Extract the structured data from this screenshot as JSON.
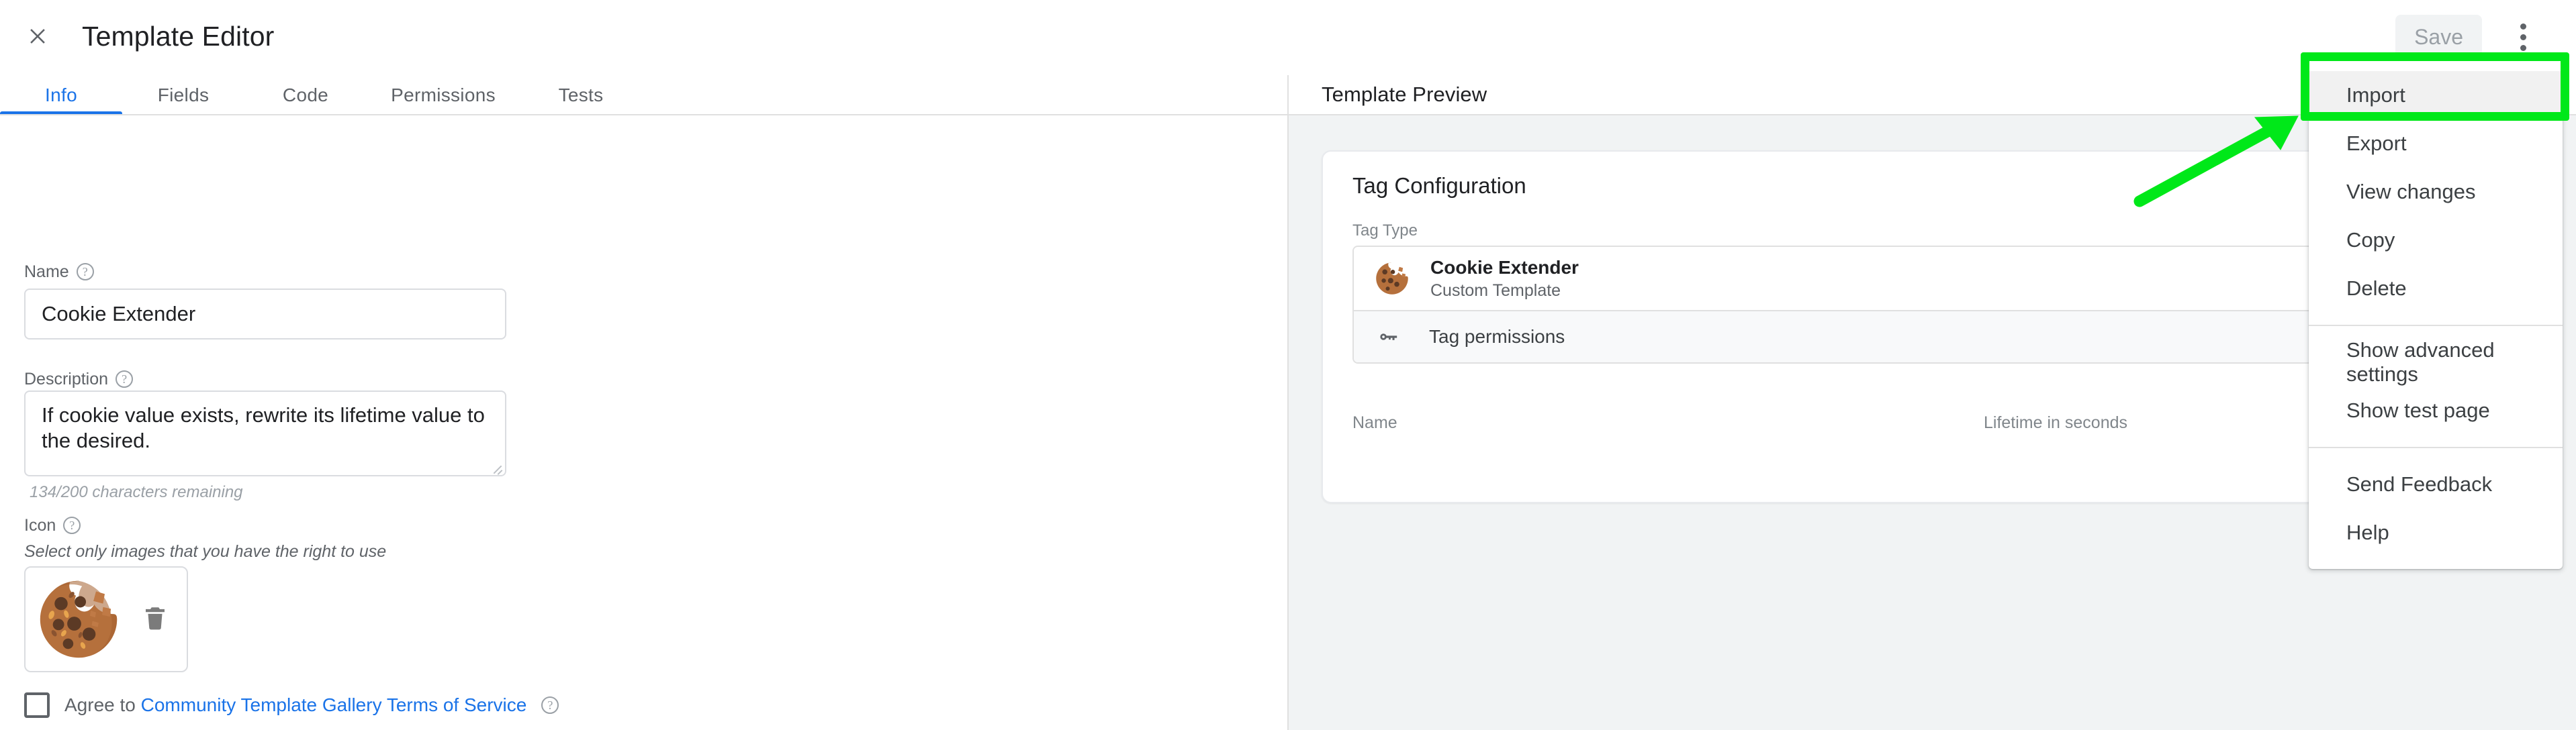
{
  "header": {
    "title": "Template Editor",
    "close_icon": "close-icon",
    "save_label": "Save",
    "overflow_icon": "more-vert-icon"
  },
  "tabs": [
    {
      "label": "Info",
      "active": true
    },
    {
      "label": "Fields",
      "active": false
    },
    {
      "label": "Code",
      "active": false
    },
    {
      "label": "Permissions",
      "active": false
    },
    {
      "label": "Tests",
      "active": false
    }
  ],
  "form": {
    "name": {
      "label": "Name",
      "value": "Cookie Extender",
      "placeholder": "",
      "help_icon": "help-icon"
    },
    "description": {
      "label": "Description",
      "value": "If cookie value exists, rewrite its lifetime value to the desired.",
      "placeholder": "",
      "help_icon": "help-icon",
      "char_count": "134/200 characters remaining"
    },
    "icon": {
      "label": "Icon",
      "help_icon": "help-icon",
      "note": "Select only images that you have the right to use",
      "thumbnail_name": "cookie-icon",
      "delete_icon": "trash-icon"
    },
    "agree": {
      "prefix": "Agree to ",
      "link": "Community Template Gallery Terms of Service",
      "help_icon": "help-icon",
      "checked": false
    }
  },
  "preview": {
    "title": "Template Preview",
    "card_title": "Tag Configuration",
    "tag_type_label": "Tag Type",
    "tag": {
      "name": "Cookie Extender",
      "subtitle": "Custom Template",
      "icon": "cookie-icon"
    },
    "permissions_row": {
      "label": "Tag permissions",
      "icon": "key-icon"
    },
    "columns": [
      {
        "label": "Name"
      },
      {
        "label": "Lifetime in seconds"
      }
    ]
  },
  "menu": {
    "items": [
      {
        "label": "Import",
        "highlighted": true
      },
      {
        "label": "Export",
        "highlighted": false
      },
      {
        "label": "View changes",
        "highlighted": false
      },
      {
        "label": "Copy",
        "highlighted": false
      },
      {
        "label": "Delete",
        "highlighted": false
      },
      {
        "separator_after": true
      },
      {
        "label": "Show advanced settings",
        "highlighted": false
      },
      {
        "label": "Show test page",
        "highlighted": false
      },
      {
        "separator_after": true
      },
      {
        "label": "Send Feedback",
        "highlighted": false
      },
      {
        "label": "Help",
        "highlighted": false
      }
    ]
  },
  "annotations": {
    "highlight_color": "#00e819",
    "arrow_target": "Import"
  },
  "colors": {
    "accent": "#1a73e8",
    "text_primary": "#202124",
    "text_secondary": "#5f6368",
    "panel_bg": "#f1f3f4",
    "border": "#e0e0e0"
  }
}
